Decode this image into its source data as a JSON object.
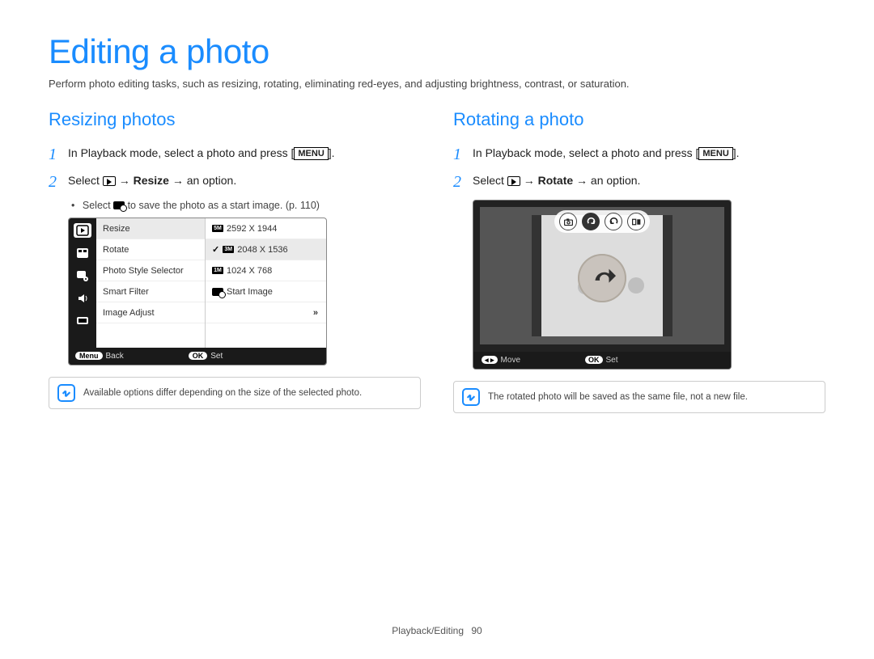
{
  "page": {
    "title": "Editing a photo",
    "intro": "Perform photo editing tasks, such as resizing, rotating, eliminating red-eyes, and adjusting brightness, contrast, or saturation.",
    "footer_section": "Playback/Editing",
    "footer_page": "90"
  },
  "left": {
    "section_title": "Resizing photos",
    "step1": {
      "num": "1",
      "prefix": "In Playback mode, select a photo and press [",
      "menu_label": "MENU",
      "suffix": "]."
    },
    "step2": {
      "num": "2",
      "prefix": "Select ",
      "arrow1": " → ",
      "bold_word": "Resize",
      "arrow2": " → an option."
    },
    "sub_bullet": {
      "prefix": "Select ",
      "suffix": " to save the photo as a start image. (p. 110)"
    },
    "shot": {
      "menu_items": [
        "Resize",
        "Rotate",
        "Photo Style Selector",
        "Smart Filter",
        "Image Adjust"
      ],
      "size_options": [
        {
          "tag": "5M",
          "label": "2592 X 1944",
          "checked": false
        },
        {
          "tag": "3M",
          "label": "2048 X 1536",
          "checked": true
        },
        {
          "tag": "1M",
          "label": "1024 X 768",
          "checked": false
        }
      ],
      "start_image_label": "Start Image",
      "more_glyph": "»",
      "footer_back_pill": "Menu",
      "footer_back_label": "Back",
      "footer_set_pill": "OK",
      "footer_set_label": "Set"
    },
    "note": "Available options differ depending on the size of the selected photo."
  },
  "right": {
    "section_title": "Rotating a photo",
    "step1": {
      "num": "1",
      "prefix": "In Playback mode, select a photo and press [",
      "menu_label": "MENU",
      "suffix": "]."
    },
    "step2": {
      "num": "2",
      "prefix": "Select ",
      "arrow1": " → ",
      "bold_word": "Rotate",
      "arrow2": " → an option."
    },
    "shot": {
      "footer_move_pill": "◂ ▸",
      "footer_move_label": "Move",
      "footer_set_pill": "OK",
      "footer_set_label": "Set"
    },
    "note": "The rotated photo will be saved as the same file, not a new file."
  }
}
